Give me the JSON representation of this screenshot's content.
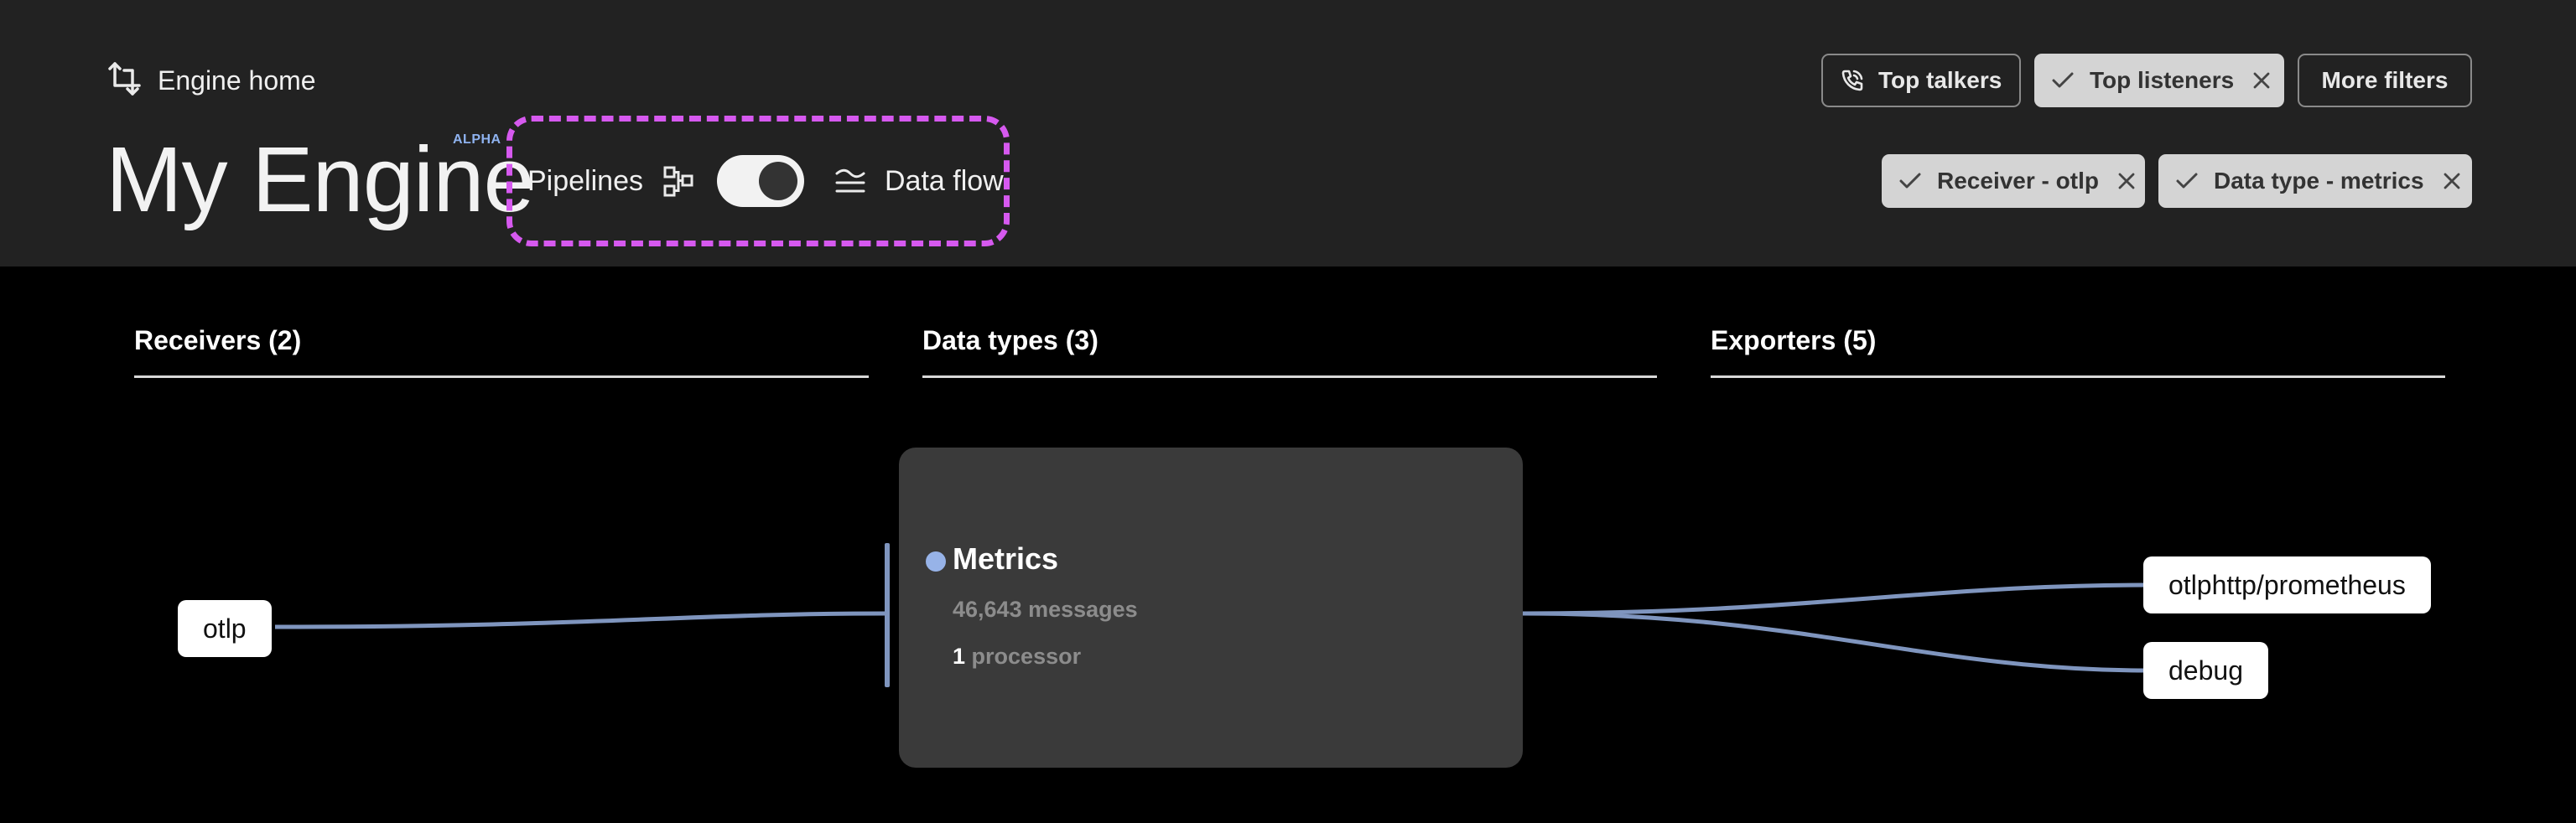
{
  "header": {
    "home_label": "Engine home",
    "title": "My Engine",
    "badge": "ALPHA",
    "view_switch": {
      "left_label": "Pipelines",
      "right_label": "Data flow",
      "state": "data-flow"
    }
  },
  "filters": {
    "row1": [
      {
        "label": "Top talkers",
        "icon": "phone-icon",
        "style": "outline"
      },
      {
        "label": "Top listeners",
        "icon": "check-icon",
        "style": "filled",
        "removable": true
      },
      {
        "label": "More filters",
        "style": "outline"
      }
    ],
    "row2": [
      {
        "label": "Receiver - otlp",
        "icon": "check-icon",
        "style": "filled",
        "removable": true
      },
      {
        "label": "Data type - metrics",
        "icon": "check-icon",
        "style": "filled",
        "removable": true
      }
    ]
  },
  "columns": [
    {
      "label": "Receivers (2)"
    },
    {
      "label": "Data types (3)"
    },
    {
      "label": "Exporters (5)"
    }
  ],
  "receivers": [
    {
      "label": "otlp"
    }
  ],
  "data_type": {
    "name": "Metrics",
    "messages": "46,643 messages",
    "processor_count": "1",
    "processor_label": "processor"
  },
  "exporters": [
    {
      "label": "otlphttp/prometheus"
    },
    {
      "label": "debug"
    }
  ],
  "colors": {
    "accent_dashed": "#d659ef",
    "edge": "#7f95be",
    "dot": "#97b3e8",
    "alpha_badge": "#8fb3f0"
  }
}
